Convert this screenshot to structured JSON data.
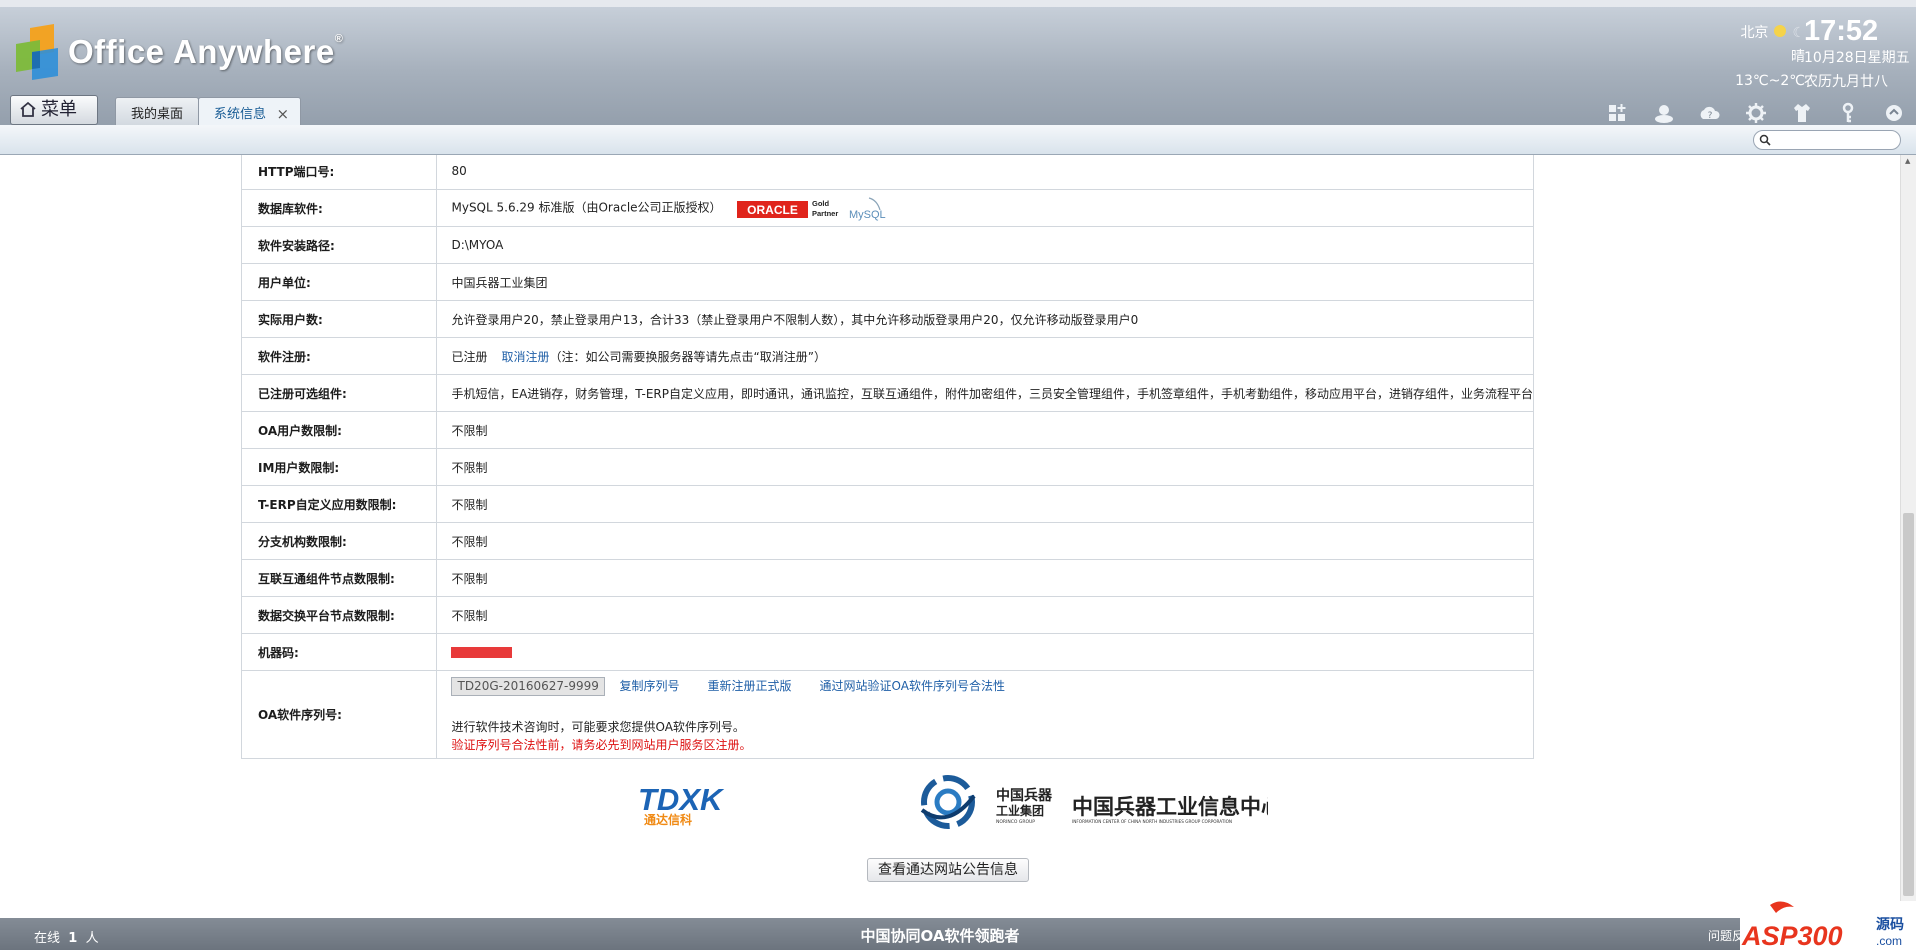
{
  "app": {
    "brand": "Office Anywhere",
    "brand_mark": "®"
  },
  "menu_button": {
    "label": "菜单"
  },
  "tabs": [
    {
      "label": "我的桌面",
      "active": false
    },
    {
      "label": "系统信息",
      "active": true,
      "close": "×"
    }
  ],
  "weather": {
    "city": "北京",
    "condition": "晴",
    "temperature": "13℃~2℃"
  },
  "clock": {
    "time": "17:52",
    "date": "10月28日星期五",
    "lunar": "农历九月廿八"
  },
  "toolbar_icons": [
    "grid-add-icon",
    "user-chat-icon",
    "cloud-help-icon",
    "gear-icon",
    "shirt-skin-icon",
    "key-icon",
    "power-icon"
  ],
  "search": {
    "placeholder": ""
  },
  "info_rows": [
    {
      "label": "HTTP端口号:",
      "value": "80"
    },
    {
      "label": "数据库软件:",
      "value": "MySQL 5.6.29 标准版（由Oracle公司正版授权）",
      "badge": {
        "oracle": "ORACLE",
        "gold": "Gold",
        "partner": "Partner",
        "mysql": "MySQL"
      }
    },
    {
      "label": "软件安装路径:",
      "value": "D:\\MYOA"
    },
    {
      "label": "用户单位:",
      "value": "中国兵器工业集团"
    },
    {
      "label": "实际用户数:",
      "value": "允许登录用户20，禁止登录用户13，合计33（禁止登录用户不限制人数），其中允许移动版登录用户20，仅允许移动版登录用户0"
    },
    {
      "label": "软件注册:",
      "value": "已注册",
      "link": "取消注册",
      "note": "（注：如公司需要换服务器等请先点击“取消注册”）"
    },
    {
      "label": "已注册可选组件:",
      "value": "手机短信，EA进销存，财务管理，T-ERP自定义应用，即时通讯，通讯监控，互联互通组件，附件加密组件，三员安全管理组件，手机签章组件，手机考勤组件，移动应用平台，进销存组件，业务流程平台"
    },
    {
      "label": "OA用户数限制:",
      "value": "不限制"
    },
    {
      "label": "IM用户数限制:",
      "value": "不限制"
    },
    {
      "label": "T-ERP自定义应用数限制:",
      "value": "不限制"
    },
    {
      "label": "分支机构数限制:",
      "value": "不限制"
    },
    {
      "label": "互联互通组件节点数限制:",
      "value": "不限制"
    },
    {
      "label": "数据交换平台节点数限制:",
      "value": "不限制"
    },
    {
      "label": "机器码:",
      "value": "",
      "redacted": true
    }
  ],
  "serial": {
    "label": "OA软件序列号:",
    "value": "TD20G-20160627-9999",
    "links": [
      "复制序列号",
      "重新注册正式版",
      "通过网站验证OA软件序列号合法性"
    ],
    "tip": "进行软件技术咨询时，可能要求您提供OA软件序列号。",
    "warning": "验证序列号合法性前，请务必先到网站用户服务区注册。"
  },
  "logos": {
    "tdxk": {
      "mark": "TDXK",
      "sub": "通达信科"
    },
    "norinco": {
      "cn_group": "中国兵器",
      "cn_group2": "工业集团",
      "en": "NORINCO GROUP",
      "center": "中国兵器工业信息中心",
      "center_en": "INFORMATION CENTER OF CHINA NORTH INDUSTRIES GROUP CORPORATION"
    }
  },
  "notice_button": {
    "label": "查看通达网站公告信息"
  },
  "status": {
    "online_prefix": "在线",
    "online_count": "1",
    "online_suffix": "人",
    "slogan": "中国协同OA软件领跑者",
    "help": "问题反"
  },
  "watermark": {
    "text": "ASP300",
    "sub": "源码",
    "domain": ".com"
  },
  "colors": {
    "link": "#1f5fa7",
    "warning": "#dd1111",
    "redacted": "#e83a3a",
    "active_tab_text": "#1a5d96"
  }
}
